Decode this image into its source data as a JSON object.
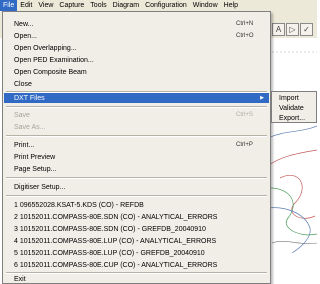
{
  "menubar": [
    "File",
    "Edit",
    "View",
    "Capture",
    "Tools",
    "Diagram",
    "Configuration",
    "Window",
    "Help"
  ],
  "file_menu": {
    "new": {
      "label": "New...",
      "shortcut": "Ctrl+N"
    },
    "open": {
      "label": "Open...",
      "shortcut": "Ctrl+O"
    },
    "open_overlapping": "Open Overlapping...",
    "open_ped": "Open PED Examination...",
    "open_composite": "Open Composite Beam",
    "close": "Close",
    "dxt_files": "DXT Files",
    "save": {
      "label": "Save",
      "shortcut": "Ctrl+S"
    },
    "save_as": "Save As...",
    "print": {
      "label": "Print...",
      "shortcut": "Ctrl+P"
    },
    "print_preview": "Print Preview",
    "page_setup": "Page Setup...",
    "digitiser_setup": "Digitiser Setup...",
    "recent_files": [
      "1 096552028.KSAT-5.KDS (CO) - REFDB",
      "2 10152011.COMPASS-80E.SDN (CO) - ANALYTICAL_ERRORS",
      "3 10152011.COMPASS-80E.SDN (CO) - GREFDB_20040910",
      "4 10152011.COMPASS-80E.LUP (CO) - ANALYTICAL_ERRORS",
      "5 10152011.COMPASS-80E.LUP (CO) - GREFDB_20040910",
      "6 10152011.COMPASS-80E.CUP (CO) - ANALYTICAL_ERRORS"
    ],
    "exit": "Exit"
  },
  "dxt_submenu": [
    "Import",
    "Validate",
    "Export..."
  ],
  "colors": {
    "menu_bg": "#f0eee6",
    "highlight": "#316ac5",
    "disabled_text": "#a7a49a"
  }
}
